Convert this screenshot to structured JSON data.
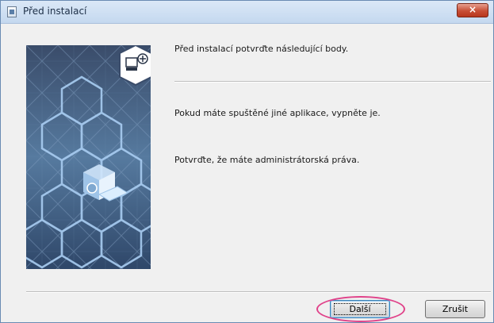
{
  "window": {
    "title": "Před instalací",
    "close_symbol": "×"
  },
  "content": {
    "header_text": "Před instalací potvrďte následující body.",
    "point1_text": "Pokud máte spuštěné jiné aplikace, vypněte je.",
    "point2_text": "Potvrďte, že máte administrátorská práva."
  },
  "buttons": {
    "next_label": "Další",
    "cancel_label": "Zrušit"
  },
  "icons": {
    "title": "installer-icon",
    "hero_badge": "computer-plus-icon"
  },
  "colors": {
    "highlight": "#e0438a",
    "close": "#c74e35"
  }
}
